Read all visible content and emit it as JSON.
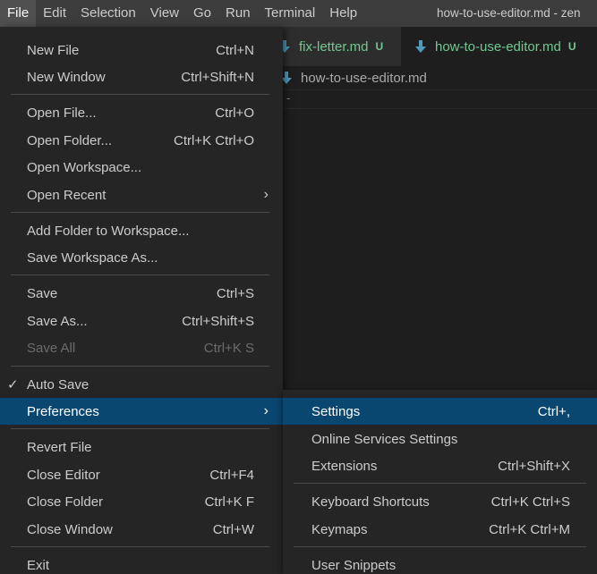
{
  "menubar": {
    "items": [
      "File",
      "Edit",
      "Selection",
      "View",
      "Go",
      "Run",
      "Terminal",
      "Help"
    ],
    "window_title": "how-to-use-editor.md - zen"
  },
  "tabs": [
    {
      "name": "fix-letter.md",
      "status": "U",
      "icon": "markdown-icon"
    },
    {
      "name": "how-to-use-editor.md",
      "status": "U",
      "icon": "markdown-icon"
    }
  ],
  "breadcrumb": {
    "file": "how-to-use-editor.md"
  },
  "editor": {
    "line1": "-"
  },
  "file_menu": {
    "new_file": {
      "label": "New File",
      "key": "Ctrl+N"
    },
    "new_window": {
      "label": "New Window",
      "key": "Ctrl+Shift+N"
    },
    "open_file": {
      "label": "Open File...",
      "key": "Ctrl+O"
    },
    "open_folder": {
      "label": "Open Folder...",
      "key": "Ctrl+K Ctrl+O"
    },
    "open_workspace": {
      "label": "Open Workspace..."
    },
    "open_recent": {
      "label": "Open Recent",
      "arrow": "›"
    },
    "add_folder": {
      "label": "Add Folder to Workspace..."
    },
    "save_workspace_as": {
      "label": "Save Workspace As..."
    },
    "save": {
      "label": "Save",
      "key": "Ctrl+S"
    },
    "save_as": {
      "label": "Save As...",
      "key": "Ctrl+Shift+S"
    },
    "save_all": {
      "label": "Save All",
      "key": "Ctrl+K S"
    },
    "auto_save": {
      "label": "Auto Save",
      "check": "✓"
    },
    "preferences": {
      "label": "Preferences",
      "arrow": "›"
    },
    "revert_file": {
      "label": "Revert File"
    },
    "close_editor": {
      "label": "Close Editor",
      "key": "Ctrl+F4"
    },
    "close_folder": {
      "label": "Close Folder",
      "key": "Ctrl+K F"
    },
    "close_window": {
      "label": "Close Window",
      "key": "Ctrl+W"
    },
    "exit": {
      "label": "Exit"
    }
  },
  "preferences_menu": {
    "settings": {
      "label": "Settings",
      "key": "Ctrl+,"
    },
    "online_services": {
      "label": "Online Services Settings"
    },
    "extensions": {
      "label": "Extensions",
      "key": "Ctrl+Shift+X"
    },
    "keyboard_shortcuts": {
      "label": "Keyboard Shortcuts",
      "key": "Ctrl+K Ctrl+S"
    },
    "keymaps": {
      "label": "Keymaps",
      "key": "Ctrl+K Ctrl+M"
    },
    "user_snippets": {
      "label": "User Snippets"
    }
  },
  "colors": {
    "selection": "#094771",
    "untracked_file": "#73c991",
    "markdown_icon": "#519aba"
  }
}
